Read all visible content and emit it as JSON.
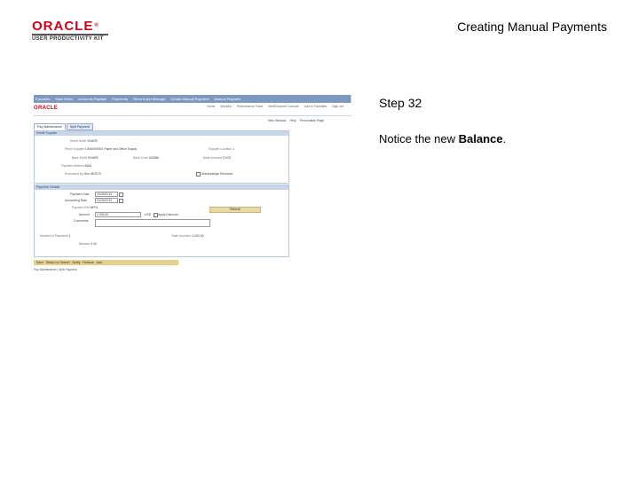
{
  "header": {
    "logo_brand": "ORACLE",
    "logo_reg": "®",
    "logo_sub": "USER PRODUCTIVITY KIT",
    "title": "Creating Manual Payments"
  },
  "step": {
    "label": "Step 32"
  },
  "instruction": {
    "prefix": "Notice the new ",
    "emphasis": "Balance",
    "suffix": "."
  },
  "screenshot": {
    "nav": [
      "Favorites",
      "Main Menu",
      "Accounts Payable",
      "Payments",
      "Record and Manage",
      "Create Manual Payment",
      "Manual Payment"
    ],
    "mini_logo": "ORACLE",
    "links": [
      "Home",
      "Worklist",
      "Performance Trace",
      "MultiChannel Console",
      "Add to Favorites",
      "Sign out"
    ],
    "sublinks": [
      "New Window",
      "Help",
      "Personalize Page"
    ],
    "tabs": [
      "Pay Maintenance",
      "Split Payment"
    ],
    "panel1_title": "Remit Supplier",
    "panel2_title": "Payment Details",
    "fields": {
      "remit_setid": "Remit SetID",
      "remit_setid_val": "SHARE",
      "remit_supplier": "Remit Supplier",
      "remit_supplier_val": "USA0000001",
      "remit_supplier_name": "Paper and Office Supply",
      "supplier_location": "Supplier Location",
      "supplier_location_val": "1",
      "bank_setid": "Bank SetID",
      "bank_setid_val": "SHARE",
      "bank_code": "Bank Code",
      "bank_code_val": "USBNK",
      "bank_account": "Bank Account",
      "bank_account_val": "CHCK",
      "payment_method": "Payment Method",
      "payment_method_val": "MAN",
      "processed_by": "Processed By",
      "processed_by_val": "Sec 08/2070",
      "acknowledge": "Acknowledge Received",
      "payment_date": "Payment Date",
      "payment_date_val": "03/26/2015",
      "accounting_date": "Accounting Date",
      "accounting_date_val": "03/26/2015",
      "payment_ref": "Payment Ref",
      "payment_ref_val": "MP01",
      "amount": "Amount",
      "amount_val": "2,000.00",
      "currency": "USD",
      "apply_discount": "Apply Discount",
      "comments": "Comments",
      "refresh": "Refresh",
      "number_of_payments": "Number of Payments",
      "number_of_payments_val": "1",
      "total_vouchers": "Total Vouchers",
      "total_vouchers_val": "2,000.00",
      "balance": "Balance",
      "balance_val": "0.00"
    },
    "toolbar": [
      "Save",
      "Return to Search",
      "Notify",
      "Refresh",
      "Add"
    ],
    "footer": "Pay Maintenance | Split Payment"
  }
}
